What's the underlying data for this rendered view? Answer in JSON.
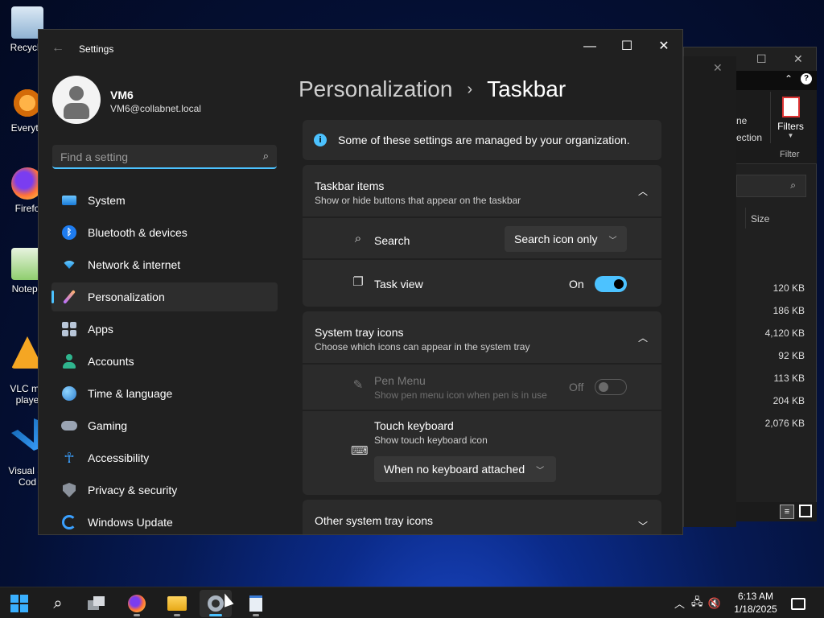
{
  "desktop": {
    "icons": [
      {
        "label": "Recycle",
        "color": "#9fc7e8"
      },
      {
        "label": "Everyth",
        "color": "#f08a1c"
      },
      {
        "label": "Firefo",
        "color": "#ff7139"
      },
      {
        "label": "Notepa",
        "color": "#7bbf5a"
      },
      {
        "label": "VLC me\nplaye",
        "color": "#f5a623"
      },
      {
        "label": "Visual St\nCod",
        "color": "#2a8ae0"
      }
    ]
  },
  "explorer": {
    "ribbon_text_1": "ne",
    "ribbon_text_2": "ection",
    "filters_label": "Filters",
    "filter_group": "Filter",
    "size_header": "Size",
    "sizes": [
      "120 KB",
      "186 KB",
      "4,120 KB",
      "92 KB",
      "113 KB",
      "204 KB",
      "2,076 KB"
    ]
  },
  "settings": {
    "window_title": "Settings",
    "profile": {
      "name": "VM6",
      "email": "VM6@collabnet.local"
    },
    "search": {
      "placeholder": "Find a setting"
    },
    "nav": [
      {
        "label": "System",
        "icon": "system-icon"
      },
      {
        "label": "Bluetooth & devices",
        "icon": "bluetooth-icon"
      },
      {
        "label": "Network & internet",
        "icon": "network-icon"
      },
      {
        "label": "Personalization",
        "icon": "brush-icon"
      },
      {
        "label": "Apps",
        "icon": "apps-icon"
      },
      {
        "label": "Accounts",
        "icon": "accounts-icon"
      },
      {
        "label": "Time & language",
        "icon": "time-language-icon"
      },
      {
        "label": "Gaming",
        "icon": "gaming-icon"
      },
      {
        "label": "Accessibility",
        "icon": "accessibility-icon"
      },
      {
        "label": "Privacy & security",
        "icon": "shield-icon"
      },
      {
        "label": "Windows Update",
        "icon": "update-icon"
      }
    ],
    "active_nav": "Personalization",
    "breadcrumb": {
      "parent": "Personalization",
      "separator": "›",
      "current": "Taskbar"
    },
    "info_banner": "Some of these settings are managed by your organization.",
    "taskbar_items": {
      "title": "Taskbar items",
      "subtitle": "Show or hide buttons that appear on the taskbar",
      "search_label": "Search",
      "search_value": "Search icon only",
      "taskview_label": "Task view",
      "taskview_state": "On"
    },
    "system_tray": {
      "title": "System tray icons",
      "subtitle": "Choose which icons can appear in the system tray",
      "pen_title": "Pen Menu",
      "pen_sub": "Show pen menu icon when pen is in use",
      "pen_state": "Off",
      "touch_title": "Touch keyboard",
      "touch_sub": "Show touch keyboard icon",
      "touch_value": "When no keyboard attached"
    },
    "other_tray": {
      "title": "Other system tray icons"
    }
  },
  "taskbar": {
    "time": "6:13 AM",
    "date": "1/18/2025"
  },
  "colors": {
    "accent": "#4cc2ff",
    "panel": "#202020",
    "card": "#2b2b2b"
  }
}
